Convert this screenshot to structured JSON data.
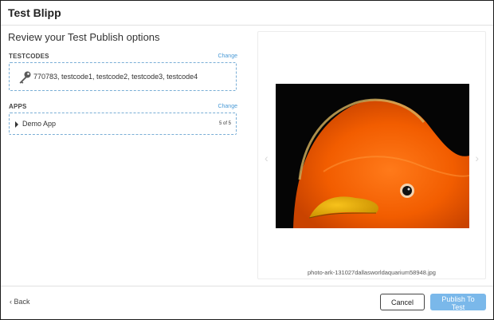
{
  "dialog": {
    "title": "Test Blipp",
    "subtitle": "Review your Test Publish options"
  },
  "testcodes": {
    "label": "TESTCODES",
    "change_label": "Change",
    "icon": "key-icon",
    "value": "770783, testcode1, testcode2, testcode3, testcode4"
  },
  "apps": {
    "label": "APPS",
    "change_label": "Change",
    "items": [
      {
        "name": "Demo App",
        "count": "5 of 5"
      }
    ]
  },
  "preview": {
    "filename": "photo-ark-131027dallasworldaquarium58948.jpg",
    "prev_glyph": "‹",
    "next_glyph": "›"
  },
  "footer": {
    "back_label": "‹ Back",
    "cancel_label": "Cancel",
    "publish_label": "Publish To Test"
  },
  "colors": {
    "accent": "#4a9ad6",
    "publish_button": "#7ab8ea",
    "dashed_border": "#7aaed6"
  }
}
